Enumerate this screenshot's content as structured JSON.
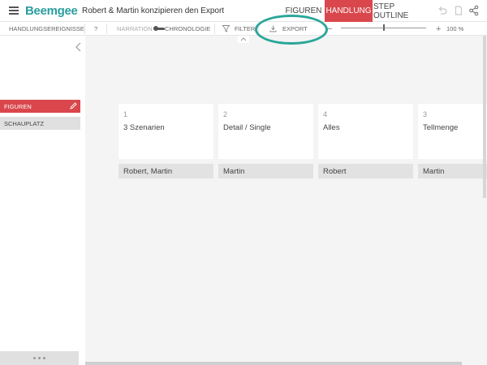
{
  "header": {
    "logo": "Beemgee",
    "title": "Robert & Martin konzipieren den Export",
    "nav": [
      {
        "label": "FIGUREN",
        "active": false
      },
      {
        "label": "HANDLUNG",
        "active": true
      },
      {
        "label": "STEP OUTLINE",
        "active": false
      }
    ],
    "icons": [
      "undo-icon",
      "document-icon",
      "share-icon"
    ]
  },
  "toolbar": {
    "handlungsereignisse": "HANDLUNGSEREIGNISSE",
    "help": "?",
    "narration": "NARRATION",
    "chronologie": "CHRONOLOGIE",
    "filter": "FILTER",
    "export": "EXPORT",
    "zoom_minus": "−",
    "zoom_plus": "+",
    "zoom_value": "100 %",
    "zoom_level": 0.5
  },
  "sidebar": {
    "items": [
      {
        "label": "FIGUREN",
        "active": true
      },
      {
        "label": "SCHAUPLATZ",
        "active": false
      }
    ]
  },
  "cards": [
    {
      "number": "1",
      "title": "3 Szenarien",
      "tag": "Robert, Martin"
    },
    {
      "number": "2",
      "title": "Detail / Single",
      "tag": "Martin"
    },
    {
      "number": "4",
      "title": "Alles",
      "tag": "Robert"
    },
    {
      "number": "3",
      "title": "Tellmenge",
      "tag": "Martin"
    }
  ],
  "colors": {
    "brand": "#2a9d9f",
    "accent": "#d9474c",
    "highlight": "#2aa69a"
  }
}
